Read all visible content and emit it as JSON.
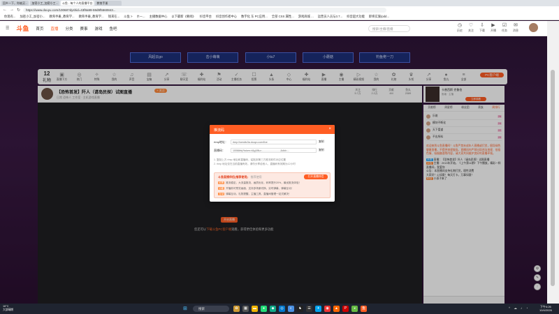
{
  "browser": {
    "tabs": [
      "回乡一下，你被买...",
      "加密小工_加密小工...",
      "斗鱼 - 每个人的直播平台",
      "教育手册"
    ],
    "url": "https://www.douyu.com/10068?dyshid=43f8a99-59d9f5560843...",
    "bookmarks": [
      "你现有...",
      "加密小工_加密小...",
      "教育手册_教育学...",
      "教育手册_教育学...",
      "钱来在...",
      "斗鱼 >",
      "ホー...",
      "主播数据中心",
      "以下最新《要闻》",
      "抖音平台",
      "抖音创作者中心",
      "数字化 东 PC应用...",
      "全部 CSS 属性...",
      "游戏商城 ...",
      "运营员人员与3.7...",
      "抖音超大功能",
      "即将实施/pdd..."
    ]
  },
  "site": {
    "logo": "斗鱼",
    "nav": [
      "首页",
      "直播",
      "分类",
      "赛事",
      "游戏",
      "鱼吧"
    ],
    "search_placeholder": "搜索/主播/直播",
    "header_icons": [
      {
        "icon": "history-icon",
        "label": "历史"
      },
      {
        "icon": "follow-icon",
        "label": "关注"
      },
      {
        "icon": "download-icon",
        "label": "下载"
      },
      {
        "icon": "broadcast-icon",
        "label": "开播"
      },
      {
        "icon": "task-icon",
        "label": "任务"
      },
      {
        "icon": "message-icon",
        "label": "消息"
      }
    ]
  },
  "promo_categories": [
    "风起云go",
    "击小萌萌",
    "小tu7",
    "小蘑菇",
    "钓鱼佬一刀"
  ],
  "category_strip": {
    "count": "12",
    "count_label": "礼物",
    "items": [
      "直播下方",
      "热门",
      "特殊",
      "我的",
      "声音",
      "宝箱",
      "分享",
      "聊天室",
      "福利站",
      "活动",
      "主播任务",
      "投票",
      "头条",
      "中心",
      "福利站",
      "直播",
      "主播",
      "精彩视频",
      "我的",
      "礼物",
      "头衔",
      "分享",
      "鱼丸",
      "全部"
    ],
    "pc_download": "PC客户端"
  },
  "room": {
    "title": "【恐怖首发】阡人（请岛民探）试图直播",
    "follow_label": "+ 关注",
    "subtitle": "日常 恐怖人 工作室 · 主机游戏直播",
    "stats": [
      {
        "label": "关注",
        "value": "5.7万"
      },
      {
        "label": "排行",
        "value": "2.2万"
      },
      {
        "label": "贡献",
        "value": "4M"
      },
      {
        "label": "鱼丸",
        "value": "2089"
      }
    ]
  },
  "side_ad": {
    "title": "卡普西斯·克鲁伯",
    "sub": "鱼塘 · 主播",
    "button": "立即观看"
  },
  "chat": {
    "tabs": [
      "贡献榜",
      "周星榜",
      "粉丝团",
      "贵族",
      "周排行"
    ],
    "ranks": [
      {
        "name": "乐佬",
        "level": "26"
      },
      {
        "name": "模块不断化",
        "level": "24"
      },
      {
        "name": "天下爱道",
        "level": "22"
      },
      {
        "name": "不出所料",
        "level": "20"
      }
    ],
    "notice": "欢迎来到斗鱼直播间！斗鱼严禁未成年人直播或打赏，倡导绿色健康直播，不提供违规服务。直播间内严禁出现违法违规、低俗色情、吸烟酗酒等内容，请大家共同维护良好的直播环境。",
    "lines": [
      "直播：【恐怖首发】阡人（请岛民探）试图直播",
      "主播：2013年开始，《上午第11期》下午播放，精彩一样直播间，我爱你",
      "公告：本直播间支持礼物打赏，理性消费",
      "大家好！心如意！每天打卡，万事如意！",
      "小孩子来了"
    ]
  },
  "modal": {
    "title": "推流码",
    "rtmp_label": "rtmp地址：",
    "rtmp_value": "rtmp://sendtc3a.douyu.com/live",
    "key_label": "直播码：",
    "key_value": "10068rfq?token=t&g1f8u=...........................&did=...",
    "copy_label": "复制",
    "tips": [
      "1. 复制上方 rtmp 地址和直播码，粘贴到第三方推流软件对应位置",
      "2. rtmp 地址仅在当前直播有效，请勿分享给他人，直播码有效期为12小时"
    ],
    "promo_title": "斗鱼直播伴侣(推荐使用)",
    "promo_sub": "推荐使用",
    "promo_button": "打开直播伴侣",
    "promo_lines": [
      {
        "k": "优势",
        "t": "推流稳定，大流量推流，画质优化，码率提升20%，最优推流体验！"
      },
      {
        "k": "功能",
        "t": "开播前可预览画面，支持多场景切换，实时弹幕，弹幕互动！"
      },
      {
        "k": "互动",
        "t": "弹幕互动，礼物提醒，主播工具，直播间管理一站式解决！"
      }
    ]
  },
  "player": {
    "open_button": "开启直播",
    "hint_prefix": "您还可以",
    "hint_link": "下载斗鱼PC客户端",
    "hint_suffix": "观看，获得更佳体验和更多功能"
  },
  "taskbar": {
    "weather_temp": "16°C",
    "weather_desc": "大部晴朗",
    "search": "搜索",
    "time": "下午4:26",
    "date": "10/4/2026"
  },
  "colors": {
    "accent": "#ff5d23",
    "stage": "#2e1538",
    "promo_btn": "#1c2f7a"
  }
}
